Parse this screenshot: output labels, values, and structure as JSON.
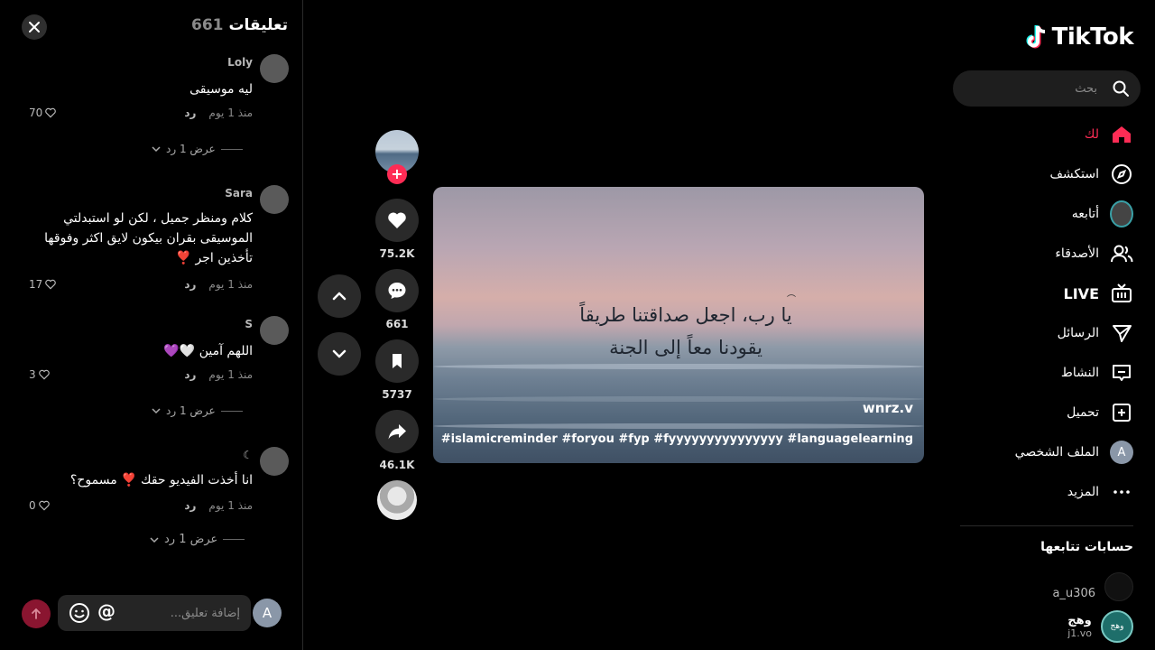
{
  "comments_panel": {
    "title": "تعليقات",
    "count": "661",
    "items": [
      {
        "author": "Loly",
        "text": "ليه موسيقى",
        "time": "منذ 1 يوم",
        "reply": "رد",
        "likes": "70",
        "view_replies": "عرض 1 رد"
      },
      {
        "author": "Sara",
        "text": "كلام ومنظر جميل ، لكن لو استبدلتي الموسيقى بقران بيكون لايق اكثر وفوقها تأخذين اجر ❣️",
        "time": "منذ 1 يوم",
        "reply": "رد",
        "likes": "17"
      },
      {
        "author": "S",
        "text": "اللهم آمين 🤍💜",
        "time": "منذ 1 يوم",
        "reply": "رد",
        "likes": "3",
        "view_replies": "عرض 1 رد"
      },
      {
        "author": "☾",
        "text": "انا أخذت الفيديو حقك ❣️ مسموح؟",
        "time": "منذ 1 يوم",
        "reply": "رد",
        "likes": "0",
        "view_replies": "عرض 1 رد"
      }
    ],
    "input_placeholder": "إضافة تعليق...",
    "my_avatar_letter": "A"
  },
  "actions": {
    "likes": "75.2K",
    "comments": "661",
    "saves": "5737",
    "shares": "46.1K"
  },
  "video": {
    "verse": "يا رب، اجعل صداقتنا طريقاً يقودنا معاً إلى الجنة",
    "handle": "wnrz.v",
    "tags": "#islamicreminder #foryou #fyp #fyyyyyyyyyyyyyyy #languagelearning"
  },
  "sidebar": {
    "logo": "TikTok",
    "search_placeholder": "بحث",
    "nav": {
      "for_you": "لك",
      "explore": "استكشف",
      "following": "أتابعه",
      "friends": "الأصدقاء",
      "live": "LIVE",
      "messages": "الرسائل",
      "activity": "النشاط",
      "upload": "تحميل",
      "profile": "الملف الشخصي",
      "more": "المزيد"
    },
    "profile_letter": "A",
    "following_title": "حسابات تتابعها",
    "accounts": [
      {
        "name": "a_u306"
      },
      {
        "name": "وهج",
        "handle": "j1.vo"
      }
    ]
  },
  "colors": {
    "accent": "#fe2c55",
    "background": "#000000",
    "panel": "#2a2a2a"
  }
}
